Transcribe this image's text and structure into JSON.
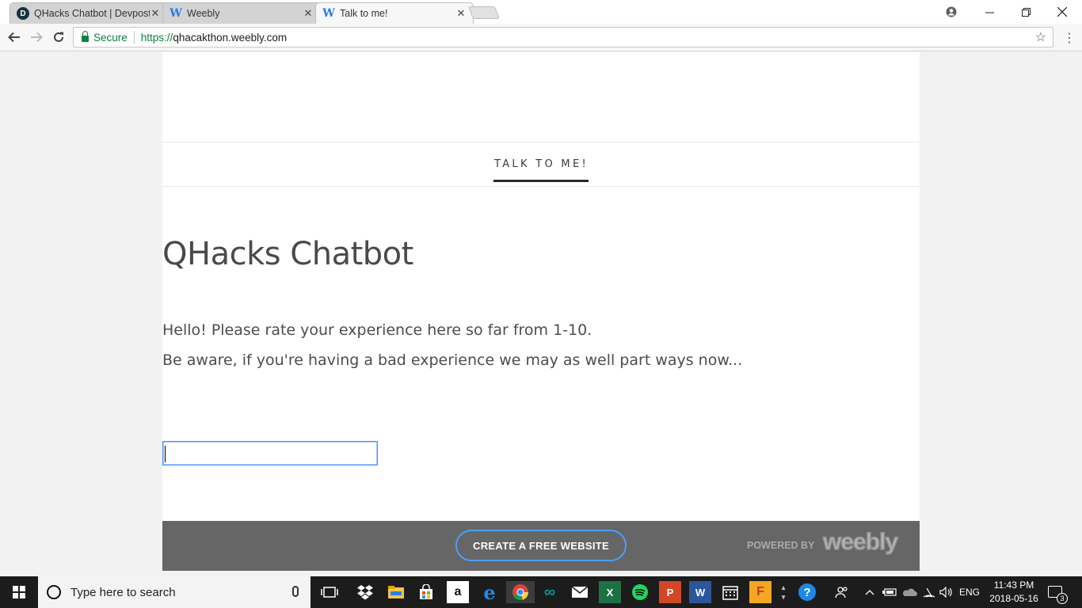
{
  "browser": {
    "tabs": [
      {
        "title": "QHacks Chatbot | Devpost",
        "favicon": "devpost-icon",
        "active": false
      },
      {
        "title": "Weebly",
        "favicon": "weebly-icon",
        "active": false
      },
      {
        "title": "Talk to me!",
        "favicon": "weebly-icon",
        "active": true
      }
    ],
    "security_label": "Secure",
    "url_scheme": "https://",
    "url_host": "qhacakthon.weebly.com"
  },
  "site": {
    "nav": {
      "active_link": "TALK TO ME!"
    },
    "title": "QHacks Chatbot",
    "paragraphs": [
      "Hello! Please rate your experience here so far from 1-10.",
      "Be aware, if you're having a bad experience we may as well part ways now..."
    ],
    "input": {
      "value": "",
      "placeholder": ""
    }
  },
  "footer": {
    "cta_label": "CREATE A FREE WEBSITE",
    "powered_by": "POWERED BY",
    "brand": "weebly",
    "cta_border_color": "#4b9fff"
  },
  "taskbar": {
    "search_placeholder": "Type here to search",
    "apps": [
      "task-view-icon",
      "dropbox-icon",
      "file-explorer-icon",
      "store-icon",
      "amazon-icon",
      "edge-icon",
      "chrome-icon",
      "arduino-icon",
      "mail-icon",
      "excel-icon",
      "spotify-icon",
      "powerpoint-icon",
      "word-icon",
      "calendar-icon",
      "fusion-icon",
      "help-icon"
    ],
    "language": "ENG",
    "time": "11:43 PM",
    "date": "2018-05-16",
    "notification_count": "3"
  },
  "colors": {
    "secure_green": "#0b8043",
    "weebly_blue": "#2b7de9",
    "footer_bg": "#666666",
    "taskbar_bg": "#1c1c1c"
  }
}
